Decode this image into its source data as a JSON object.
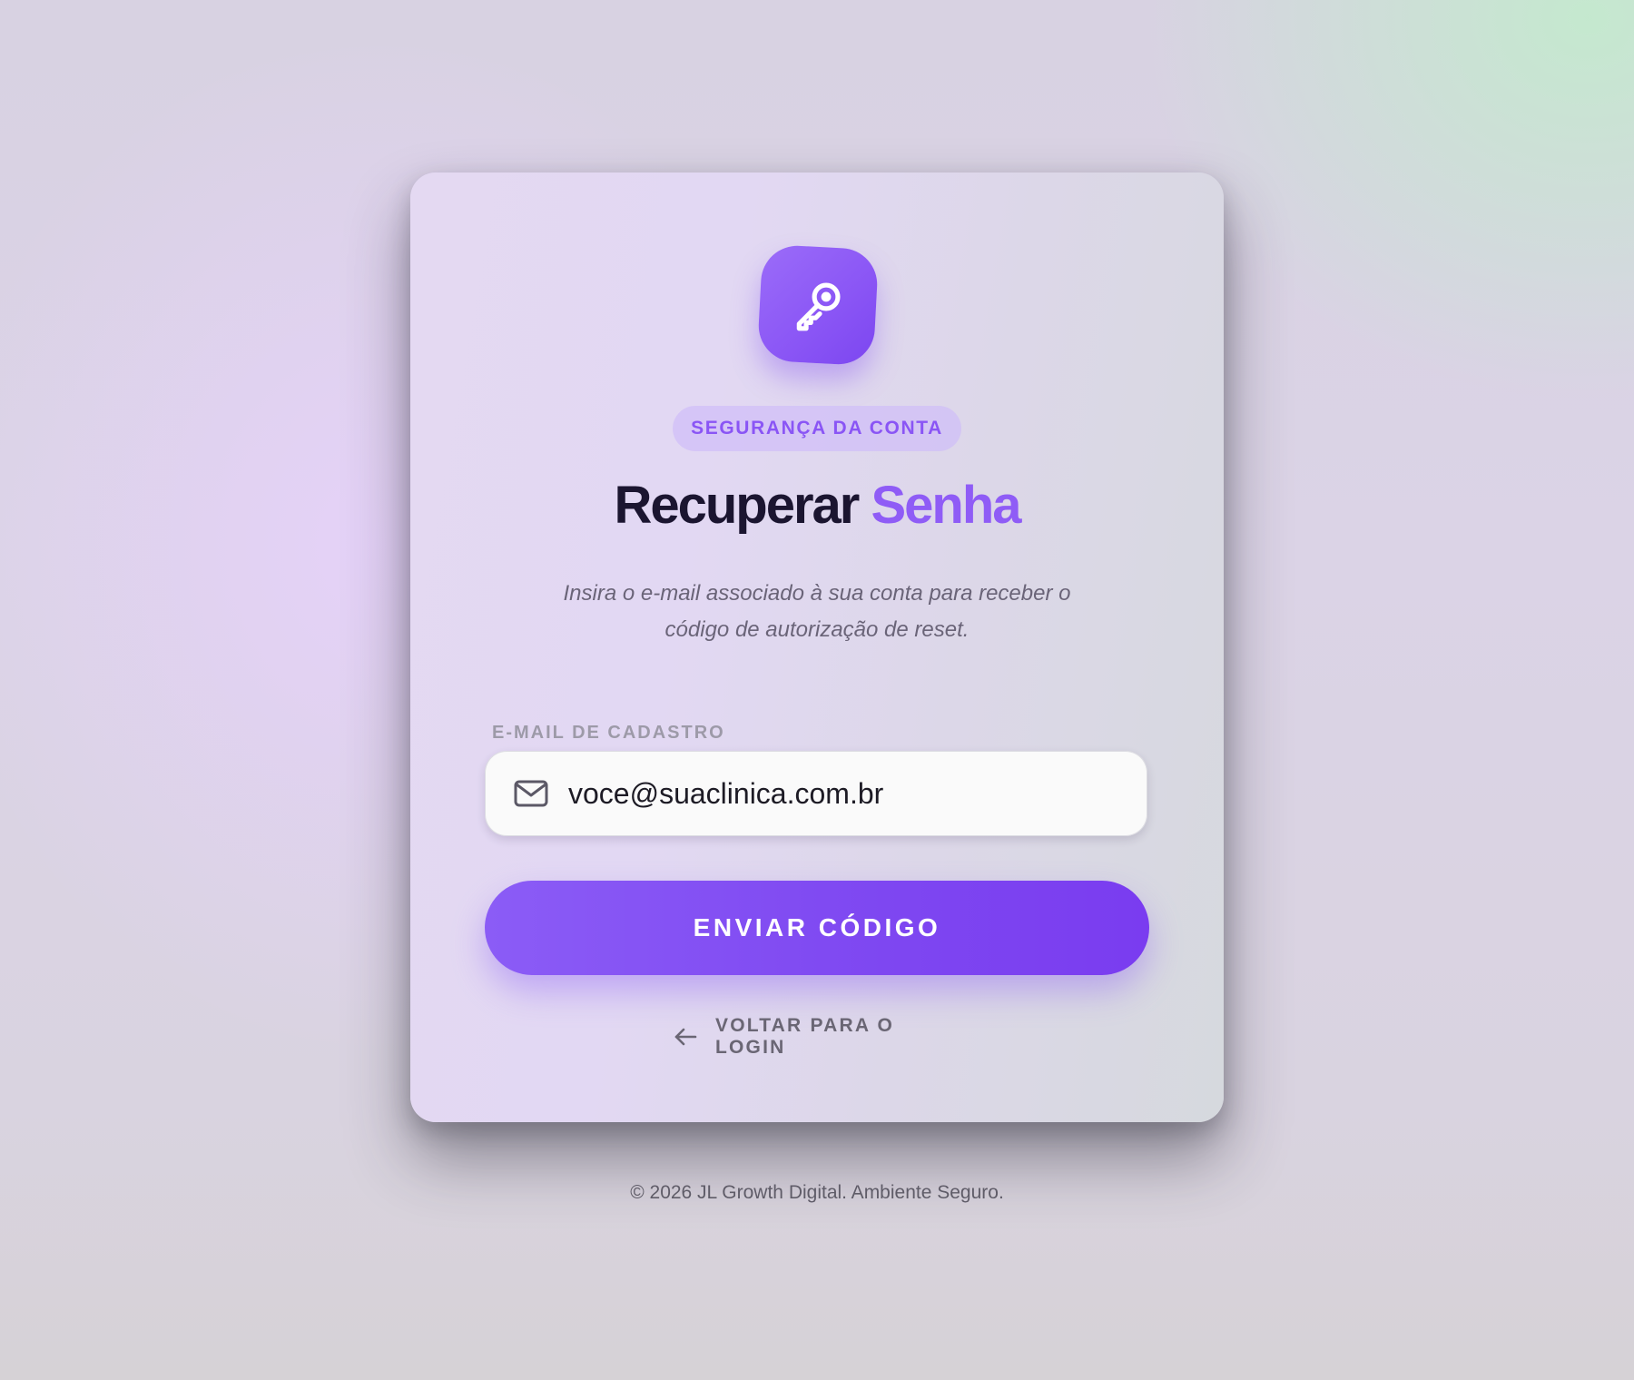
{
  "card": {
    "logo_icon": "key-icon",
    "badge": "SEGURANÇA DA CONTA",
    "title_main": "Recuperar",
    "title_accent": "Senha",
    "subtitle_line1": "Insira o e-mail associado à sua conta para receber o",
    "subtitle_line2": "código de autorização de reset.",
    "email": {
      "label": "E-MAIL DE CADASTRO",
      "icon": "mail-icon",
      "value": "voce@suaclinica.com.br"
    },
    "submit_label": "ENVIAR CÓDIGO",
    "back": {
      "icon": "arrow-left-icon",
      "label": "VOLTAR PARA O LOGIN"
    }
  },
  "footer": "© 2026 JL Growth Digital. Ambiente Seguro.",
  "colors": {
    "accent": "#8b5cf6",
    "title": "#1b1530",
    "button_end": "#7a3cf0"
  }
}
